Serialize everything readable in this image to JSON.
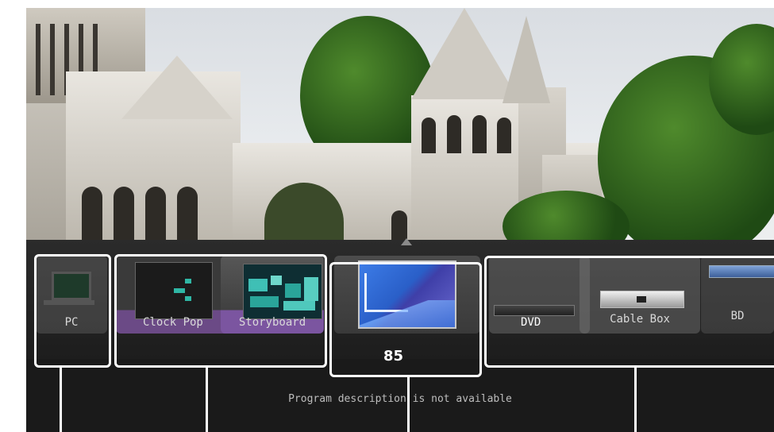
{
  "sources": [
    {
      "id": "pc",
      "label": "PC",
      "icon": "laptop-icon"
    },
    {
      "id": "clock",
      "label": "Clock Pop",
      "icon": "clock-pop-thumbnail"
    },
    {
      "id": "story",
      "label": "Storyboard",
      "icon": "storyboard-thumbnail"
    },
    {
      "id": "tv",
      "label": "85",
      "icon": "tv-channel-thumbnail"
    },
    {
      "id": "dvd",
      "label": "DVD",
      "icon": "dvd-player-icon"
    },
    {
      "id": "cable",
      "label": "Cable Box",
      "icon": "cable-box-icon"
    },
    {
      "id": "bd",
      "label": "BD",
      "icon": "bluray-player-icon"
    }
  ],
  "selected_channel": "85",
  "program_description": "Program description is not available",
  "colors": {
    "osd_background": "#1a1a1a",
    "app_accent_purple": "#7b55a0",
    "highlight_frame": "#ffffff",
    "tv_blue": "#2f6fd6"
  }
}
